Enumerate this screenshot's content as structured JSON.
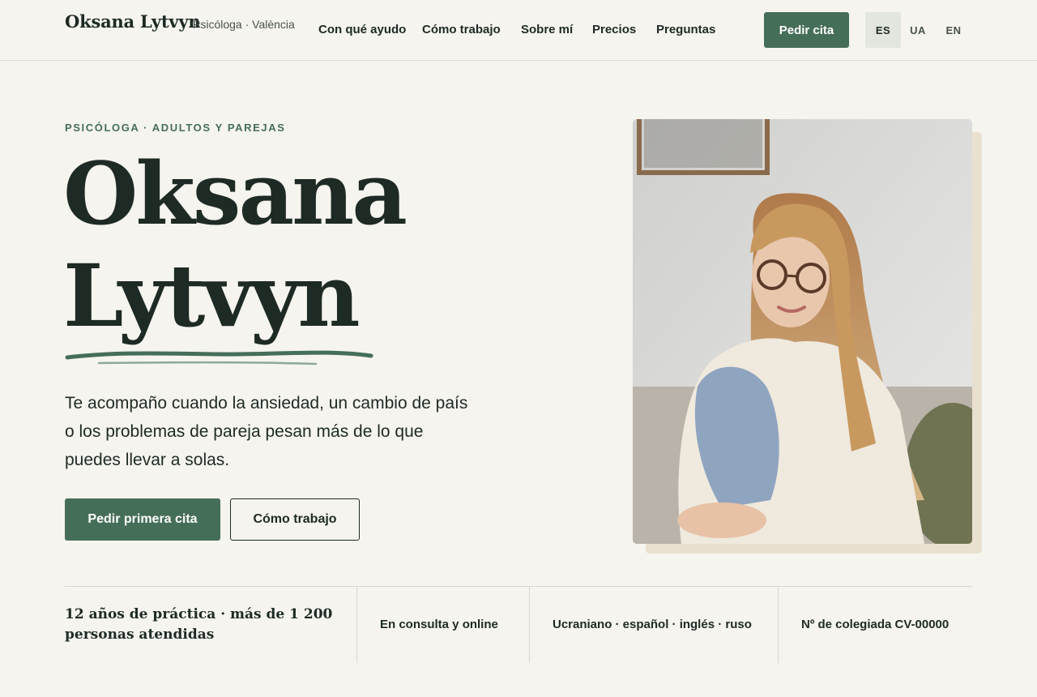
{
  "header": {
    "brand_name": "Oksana Lytvyn",
    "brand_tagline": "Psicóloga · València",
    "nav": [
      "Con qué ayudo",
      "Cómo trabajo",
      "Sobre mí",
      "Precios",
      "Preguntas"
    ],
    "cta_label": "Pedir cita",
    "languages": [
      "ES",
      "UA",
      "EN"
    ],
    "active_language": "ES"
  },
  "hero": {
    "eyebrow": "PSICÓLOGA · ADULTOS Y PAREJAS",
    "name_line1": "Oksana",
    "name_line2": "Lytvyn",
    "lead": "Te acompaño cuando la ansiedad, un cambio de país o los problemas de pareja pesan más de lo que puedes llevar a solas.",
    "primary_cta": "Pedir primera cita",
    "secondary_cta": "Cómo trabajo"
  },
  "facts": {
    "experience": "12 años de práctica · más de 1 200 personas atendidas",
    "modality": "En consulta y online",
    "languages": "Ucraniano · español · inglés · ruso",
    "license": "Nº de colegiada CV-00000"
  },
  "colors": {
    "accent": "#456e58",
    "background": "#f5f4ef",
    "text": "#1e2a24",
    "photo_backing": "#e9e0d0"
  }
}
